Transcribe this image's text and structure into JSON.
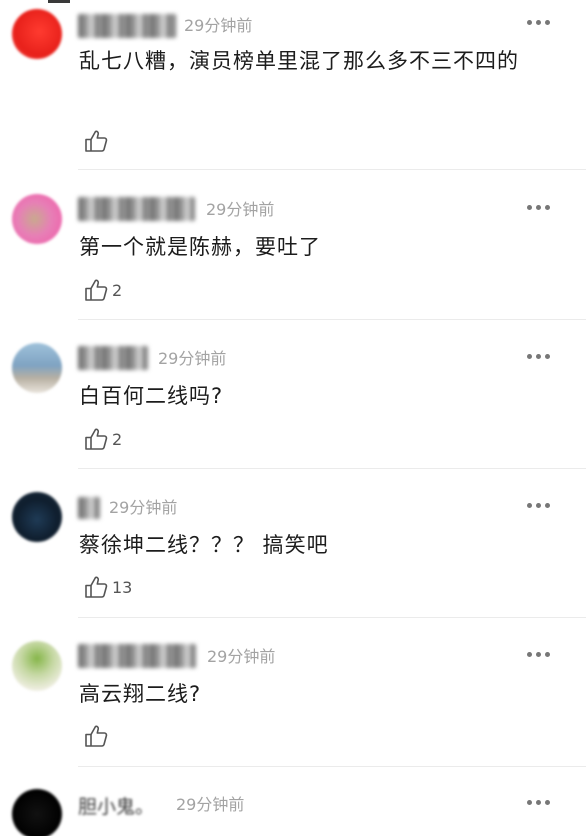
{
  "comments": [
    {
      "avatar_style": "red",
      "username_blurred": true,
      "time": "29分钟前",
      "text": "乱七八糟，演员榜单里混了那么多不三不四的",
      "like_count": ""
    },
    {
      "avatar_style": "pink",
      "username_blurred": true,
      "time": "29分钟前",
      "text": "第一个就是陈赫，要吐了",
      "like_count": "2"
    },
    {
      "avatar_style": "sky",
      "username_blurred": true,
      "time": "29分钟前",
      "text": "白百何二线吗?",
      "like_count": "2"
    },
    {
      "avatar_style": "dark-blue",
      "username_blurred": true,
      "time": "29分钟前",
      "text": "蔡徐坤二线？？？ 搞笑吧",
      "like_count": "13"
    },
    {
      "avatar_style": "green",
      "username_blurred": true,
      "time": "29分钟前",
      "text": "高云翔二线?",
      "like_count": ""
    },
    {
      "avatar_style": "black",
      "username": "胆小鬼。",
      "time": "29分钟前",
      "text": "",
      "like_count": ""
    }
  ],
  "icons": {
    "more": "more-dots-icon",
    "like": "thumbs-up-icon"
  },
  "colors": {
    "time_text": "#a3a3a3",
    "comment_text": "#1c1c1c",
    "divider": "#ebebeb"
  }
}
